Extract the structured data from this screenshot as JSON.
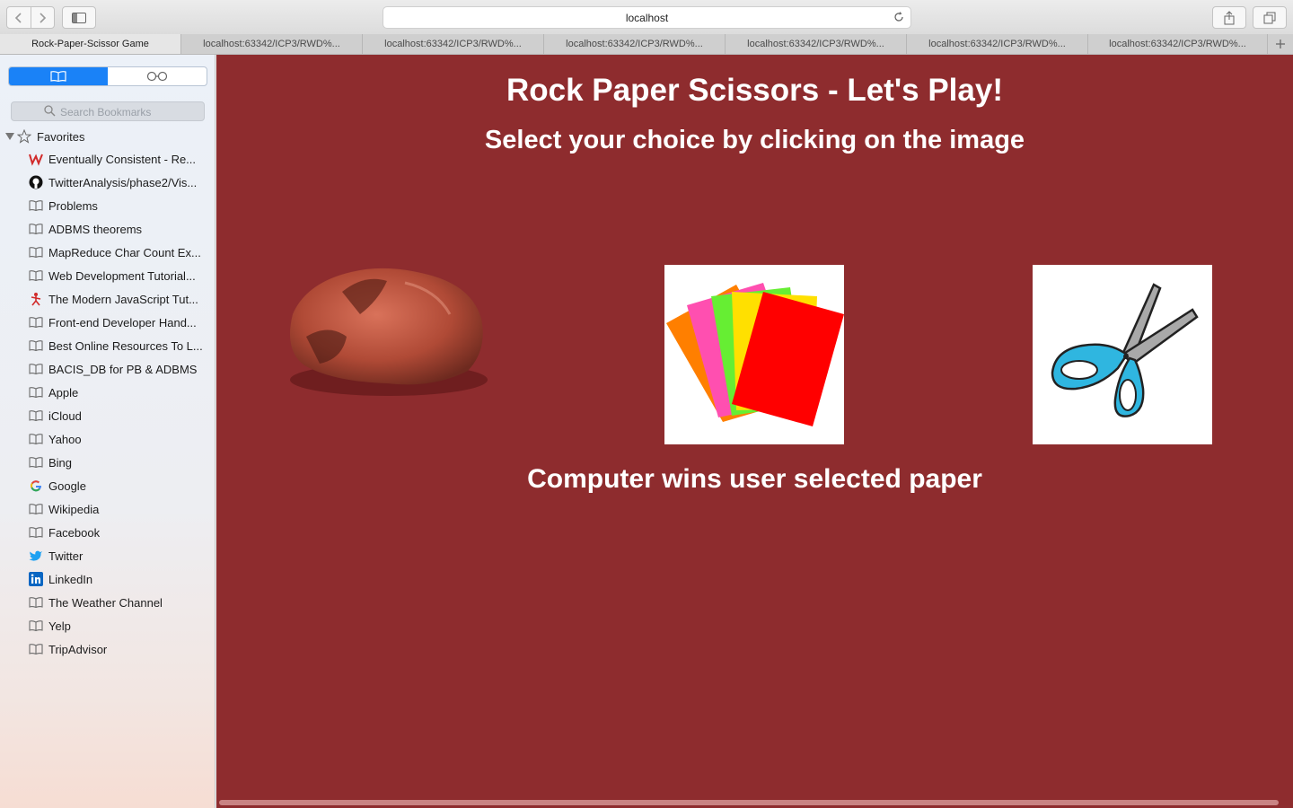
{
  "browser": {
    "address": "localhost",
    "tabs": [
      {
        "label": "Rock-Paper-Scissor Game",
        "active": true
      },
      {
        "label": "localhost:63342/ICP3/RWD%...",
        "active": false
      },
      {
        "label": "localhost:63342/ICP3/RWD%...",
        "active": false
      },
      {
        "label": "localhost:63342/ICP3/RWD%...",
        "active": false
      },
      {
        "label": "localhost:63342/ICP3/RWD%...",
        "active": false
      },
      {
        "label": "localhost:63342/ICP3/RWD%...",
        "active": false
      },
      {
        "label": "localhost:63342/ICP3/RWD%...",
        "active": false
      }
    ]
  },
  "sidebar": {
    "search_placeholder": "Search Bookmarks",
    "favorites_label": "Favorites",
    "bookmarks": [
      {
        "label": "Eventually Consistent - Re...",
        "icon": "w-logo-icon"
      },
      {
        "label": "TwitterAnalysis/phase2/Vis...",
        "icon": "github-icon"
      },
      {
        "label": "Problems",
        "icon": "book-icon"
      },
      {
        "label": "ADBMS theorems",
        "icon": "book-icon"
      },
      {
        "label": "MapReduce Char Count Ex...",
        "icon": "book-icon"
      },
      {
        "label": "Web Development Tutorial...",
        "icon": "book-icon"
      },
      {
        "label": "The Modern JavaScript Tut...",
        "icon": "js-figure-icon"
      },
      {
        "label": "Front-end Developer Hand...",
        "icon": "book-icon"
      },
      {
        "label": "Best Online Resources To L...",
        "icon": "book-icon"
      },
      {
        "label": "BACIS_DB for PB & ADBMS",
        "icon": "book-icon"
      },
      {
        "label": "Apple",
        "icon": "book-icon"
      },
      {
        "label": "iCloud",
        "icon": "book-icon"
      },
      {
        "label": "Yahoo",
        "icon": "book-icon"
      },
      {
        "label": "Bing",
        "icon": "book-icon"
      },
      {
        "label": "Google",
        "icon": "google-icon"
      },
      {
        "label": "Wikipedia",
        "icon": "book-icon"
      },
      {
        "label": "Facebook",
        "icon": "book-icon"
      },
      {
        "label": "Twitter",
        "icon": "twitter-icon"
      },
      {
        "label": "LinkedIn",
        "icon": "linkedin-icon"
      },
      {
        "label": "The Weather Channel",
        "icon": "book-icon"
      },
      {
        "label": "Yelp",
        "icon": "book-icon"
      },
      {
        "label": "TripAdvisor",
        "icon": "book-icon"
      }
    ]
  },
  "game": {
    "title": "Rock Paper Scissors - Let's Play!",
    "subtitle": "Select your choice by clicking on the image",
    "result": "Computer wins user selected paper"
  },
  "colors": {
    "content_bg": "#8e2c2e",
    "sidebar_accent": "#1a82f7"
  }
}
